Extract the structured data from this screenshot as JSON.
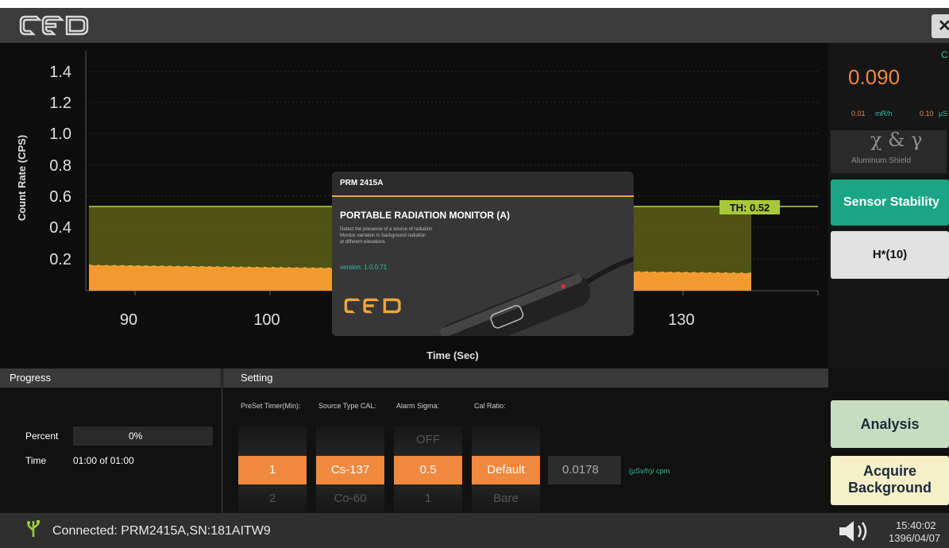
{
  "topbar": {
    "close_label": "✕"
  },
  "chart": {
    "ylabel": "Count Rate (CPS)",
    "yticks": [
      "1.4",
      "1.2",
      "1.0",
      "0.8",
      "0.6",
      "0.4",
      "0.2"
    ],
    "xticks": [
      "90",
      "100",
      "130"
    ],
    "xlabel": "Time (Sec)",
    "threshold_label": "TH: 0.52"
  },
  "chart_data": {
    "type": "area",
    "title": "",
    "xlabel": "Time (Sec)",
    "ylabel": "Count Rate (CPS)",
    "xlim": [
      83,
      140
    ],
    "ylim": [
      0,
      1.5
    ],
    "threshold": 0.52,
    "series": [
      {
        "x": [
          84,
          135
        ],
        "y": [
          0.16,
          0.09
        ]
      }
    ]
  },
  "splash": {
    "model": "PRM 2415A",
    "title": "PORTABLE RADIATION MONITOR (A)",
    "desc1": "Detect the presence of a source of radiation",
    "desc2": "Monitor variation in background radiation",
    "desc3": "at different elevations",
    "version": "version: 1.0.0.71"
  },
  "side": {
    "corner_label": "C",
    "dose_value": "0.090",
    "unit1_value": "0.01",
    "unit1": "mR/h",
    "unit2_value": "0.10",
    "unit2": "µS",
    "xg_title": "χ & γ",
    "xg_sub": "Aluminum Shield",
    "sensor_btn": "Sensor Stability",
    "h10_btn": "H*(10)",
    "analysis_btn": "Analysis",
    "acquire_btn1": "Acquire",
    "acquire_btn2": "Background",
    "colors": {
      "teal": "#1aa585",
      "orange": "#f0883e",
      "green_panel": "#c8dcc0",
      "cream": "#f6f0c8"
    }
  },
  "progress": {
    "header": "Progress",
    "percent_label": "Percent",
    "percent_value": "0%",
    "percent_fraction": 0,
    "time_label": "Time",
    "time_value": "01:00 of 01:00"
  },
  "setting": {
    "header": "Setting",
    "col1": "PreSet Timer(Min):",
    "col2": "Source Type CAL:",
    "col3": "Alarm Sigma:",
    "col4": "Cal Ratio:",
    "timer_selected": "1",
    "timer_next": "2",
    "source_selected": "Cs-137",
    "source_next": "Co-60",
    "sigma_prev": "OFF",
    "sigma_selected": "0.5",
    "sigma_next": "1",
    "ratio_selected": "Default",
    "ratio_next": "Bare",
    "ratio_value": "0.0178",
    "ratio_unit": "(µSv/h)/ cpm"
  },
  "status": {
    "connection": "Connected: PRM2415A,SN:181AITW9",
    "time": "15:40:02",
    "date": "1396/04/07"
  }
}
